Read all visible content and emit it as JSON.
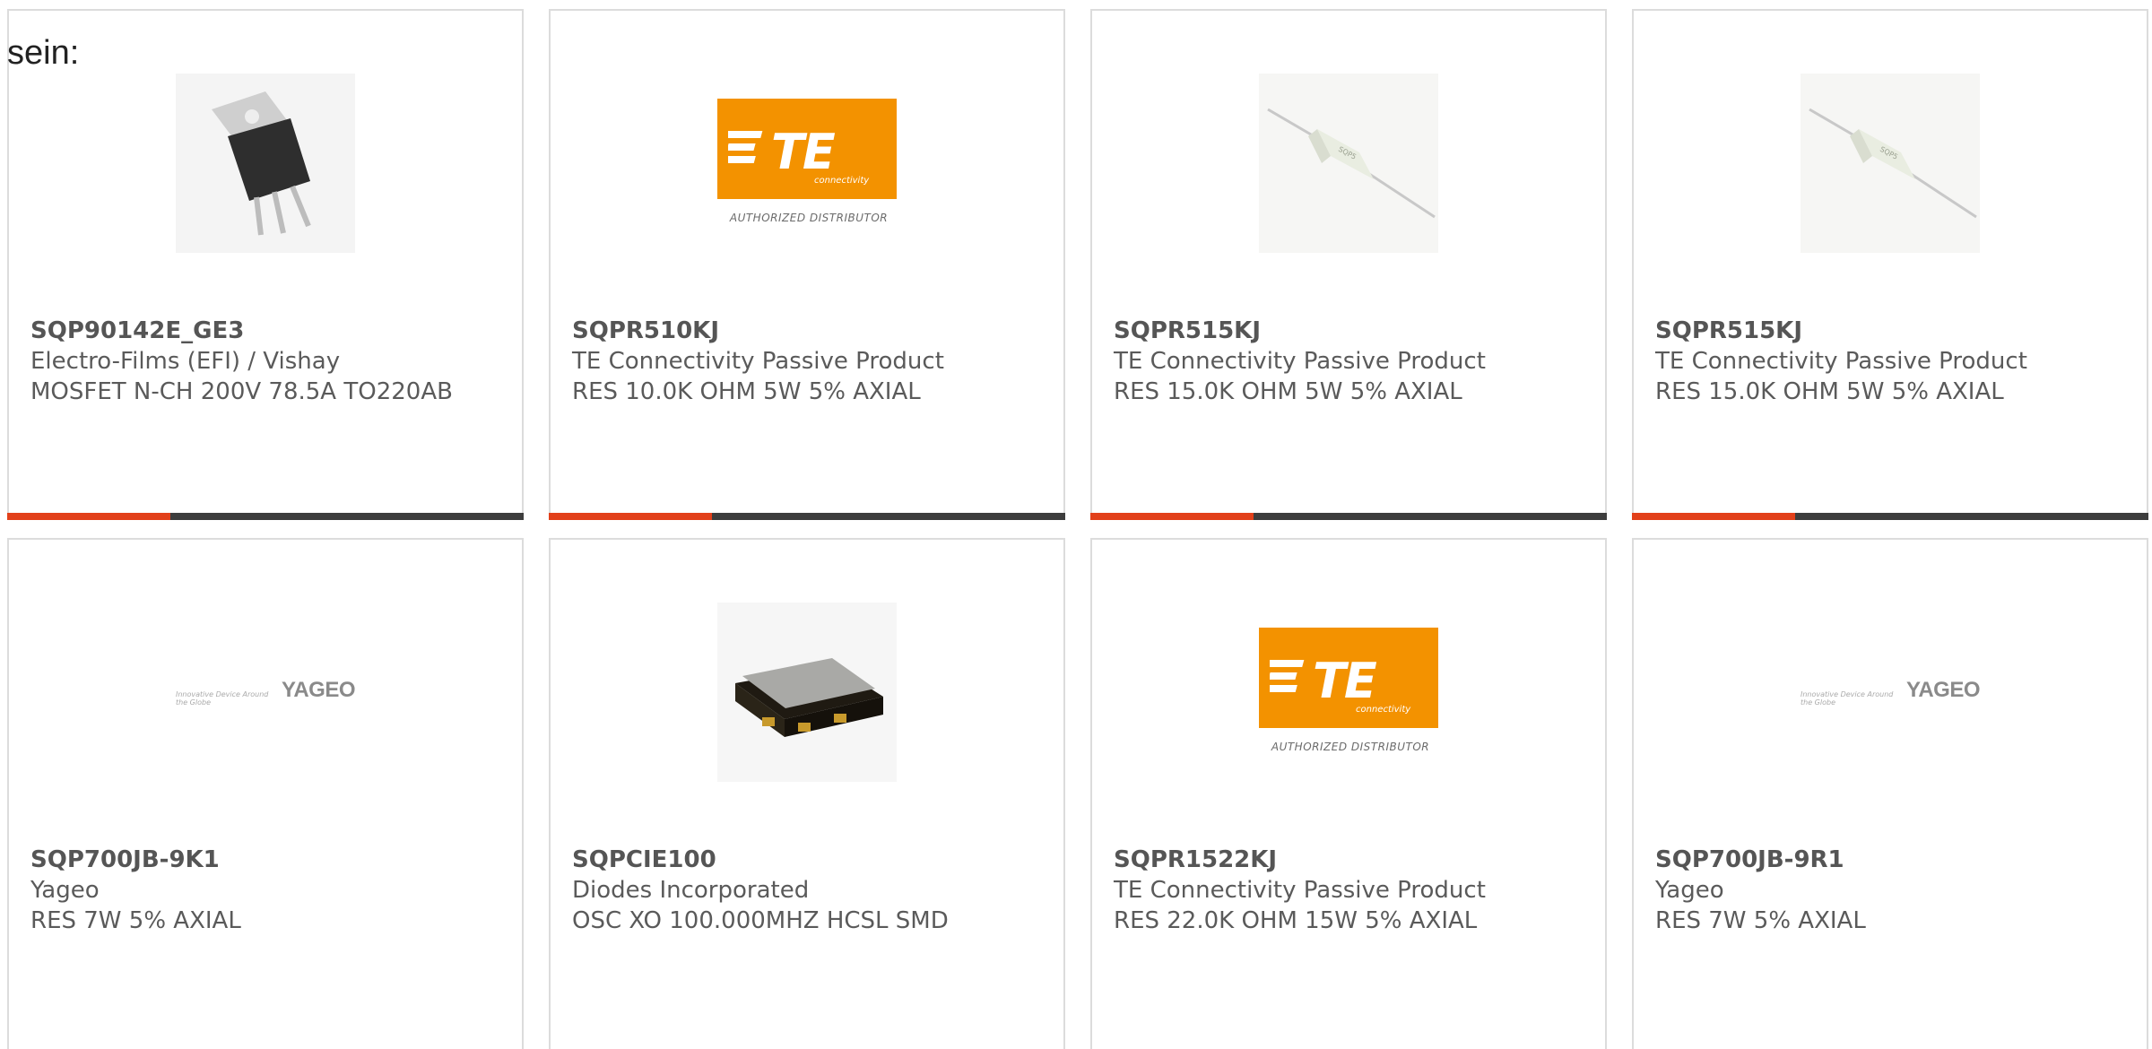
{
  "intro_text": "sein:",
  "colors": {
    "accent": "#e2401a",
    "bar": "#3d3d3d",
    "te_orange": "#f39200",
    "border": "#dcdcdc"
  },
  "products": [
    {
      "part": "SQP90142E_GE3",
      "manufacturer": "Electro-Films (EFI) / Vishay",
      "description": "MOSFET N-CH 200V 78.5A TO220AB",
      "image": "to220-transistor-icon"
    },
    {
      "part": "SQPR510KJ",
      "manufacturer": "TE Connectivity Passive Product",
      "description": "RES 10.0K OHM 5W 5% AXIAL",
      "image": "te-connectivity-logo"
    },
    {
      "part": "SQPR515KJ",
      "manufacturer": "TE Connectivity Passive Product",
      "description": "RES 15.0K OHM 5W 5% AXIAL",
      "image": "ceramic-resistor-icon"
    },
    {
      "part": "SQPR515KJ",
      "manufacturer": "TE Connectivity Passive Product",
      "description": "RES 15.0K OHM 5W 5% AXIAL",
      "image": "ceramic-resistor-icon"
    },
    {
      "part": "SQP700JB-9K1",
      "manufacturer": "Yageo",
      "description": "RES 7W 5% AXIAL",
      "image": "yageo-logo"
    },
    {
      "part": "SQPCIE100",
      "manufacturer": "Diodes Incorporated",
      "description": "OSC XO 100.000MHZ HCSL SMD",
      "image": "oscillator-chip-icon"
    },
    {
      "part": "SQPR1522KJ",
      "manufacturer": "TE Connectivity Passive Product",
      "description": "RES 22.0K OHM 15W 5% AXIAL",
      "image": "te-connectivity-logo"
    },
    {
      "part": "SQP700JB-9R1",
      "manufacturer": "Yageo",
      "description": "RES 7W 5% AXIAL",
      "image": "yageo-logo"
    }
  ],
  "logos": {
    "te_text": "TE",
    "te_sub": "connectivity",
    "te_distributor": "AUTHORIZED DISTRIBUTOR",
    "yageo_tagline": "Innovative Device Around the Globe",
    "yageo_name": "YAGEO"
  }
}
